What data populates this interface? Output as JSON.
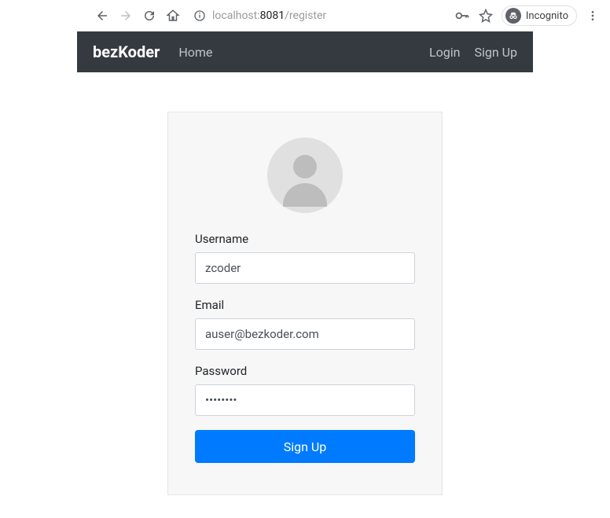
{
  "browser": {
    "url_prefix": "localhost:",
    "url_port": "8081",
    "url_path": "/register",
    "incognito_label": "Incognito"
  },
  "navbar": {
    "brand": "bezKoder",
    "home": "Home",
    "login": "Login",
    "signup": "Sign Up"
  },
  "form": {
    "username_label": "Username",
    "username_value": "zcoder",
    "email_label": "Email",
    "email_value": "auser@bezkoder.com",
    "password_label": "Password",
    "password_value": "••••••••",
    "submit_label": "Sign Up"
  }
}
